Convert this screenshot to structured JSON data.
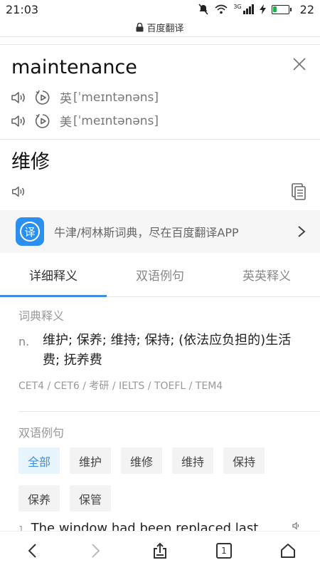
{
  "status_bar": {
    "time": "21:03",
    "network_label": "3G",
    "battery_level": "22",
    "battery_fraction": 0.22,
    "battery_color": "#21b14a"
  },
  "url_bar": {
    "title": "百度翻译",
    "icon": "lock-icon"
  },
  "word": {
    "text": "maintenance",
    "phonetics": [
      {
        "region": "英",
        "ipa": "[ˈmeɪntənəns]"
      },
      {
        "region": "美",
        "ipa": "[ˈmeɪntənəns]"
      }
    ]
  },
  "translation": {
    "text": "维修"
  },
  "banner": {
    "logo_char": "译",
    "text": "牛津/柯林斯词典，尽在百度翻译APP",
    "accent": "#2b8ff0"
  },
  "tabs": [
    {
      "label": "详细释义",
      "active": true
    },
    {
      "label": "双语例句",
      "active": false
    },
    {
      "label": "英英释义",
      "active": false
    }
  ],
  "dictionary": {
    "title": "词典释义",
    "pos": "n.",
    "definition": "维护; 保养; 维持; 保持; (依法应负担的)生活费; 抚养费",
    "levels": "CET4 / CET6 / 考研 / IELTS / TOEFL / TEM4"
  },
  "examples": {
    "title": "双语例句",
    "filters": [
      {
        "label": "全部",
        "active": true
      },
      {
        "label": "维护",
        "active": false
      },
      {
        "label": "维修",
        "active": false
      },
      {
        "label": "维持",
        "active": false
      },
      {
        "label": "保持",
        "active": false
      },
      {
        "label": "保养",
        "active": false
      },
      {
        "label": "保管",
        "active": false
      }
    ],
    "first_sentence_number": "1",
    "first_sentence": "The window had been replaced last"
  },
  "bottom_nav": {
    "tab_count": "1"
  },
  "colors": {
    "accent": "#3c8fe3",
    "chip_active_bg": "#e8f4fc"
  }
}
